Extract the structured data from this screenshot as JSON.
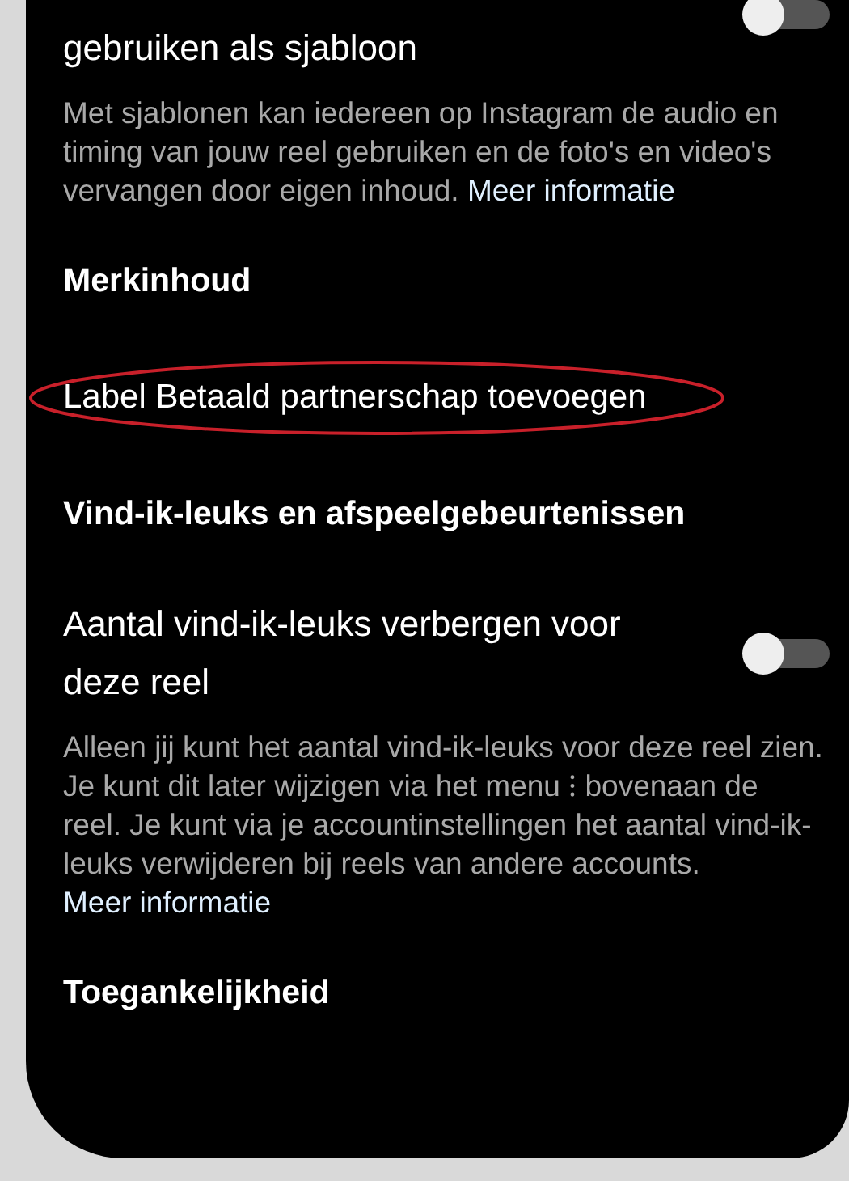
{
  "settings": [
    {
      "kind": "toggle",
      "label": "gebruiken als sjabloon",
      "on": false,
      "description": "Met sjablonen kan iedereen op Instagram de audio en timing van jouw reel gebruiken en de foto's en video's vervangen door eigen inhoud.",
      "link": "Meer informatie"
    },
    {
      "kind": "heading",
      "label": "Merkinhoud"
    },
    {
      "kind": "item",
      "label": "Label Betaald partnerschap toevoegen",
      "circled": true
    },
    {
      "kind": "heading",
      "label": "Vind-ik-leuks en afspeelgebeurtenissen"
    },
    {
      "kind": "toggle",
      "label": "Aantal vind-ik-leuks verbergen voor deze reel",
      "on": false,
      "description": "Alleen jij kunt het aantal vind-ik-leuks voor deze reel zien. Je kunt dit later wijzigen via het menu ⁝ bovenaan de reel. Je kunt via je accountinstellingen het aantal vind-ik-leuks verwijderen bij reels van andere accounts.",
      "link": "Meer informatie"
    },
    {
      "kind": "heading",
      "label": "Toegankelijkheid"
    }
  ]
}
